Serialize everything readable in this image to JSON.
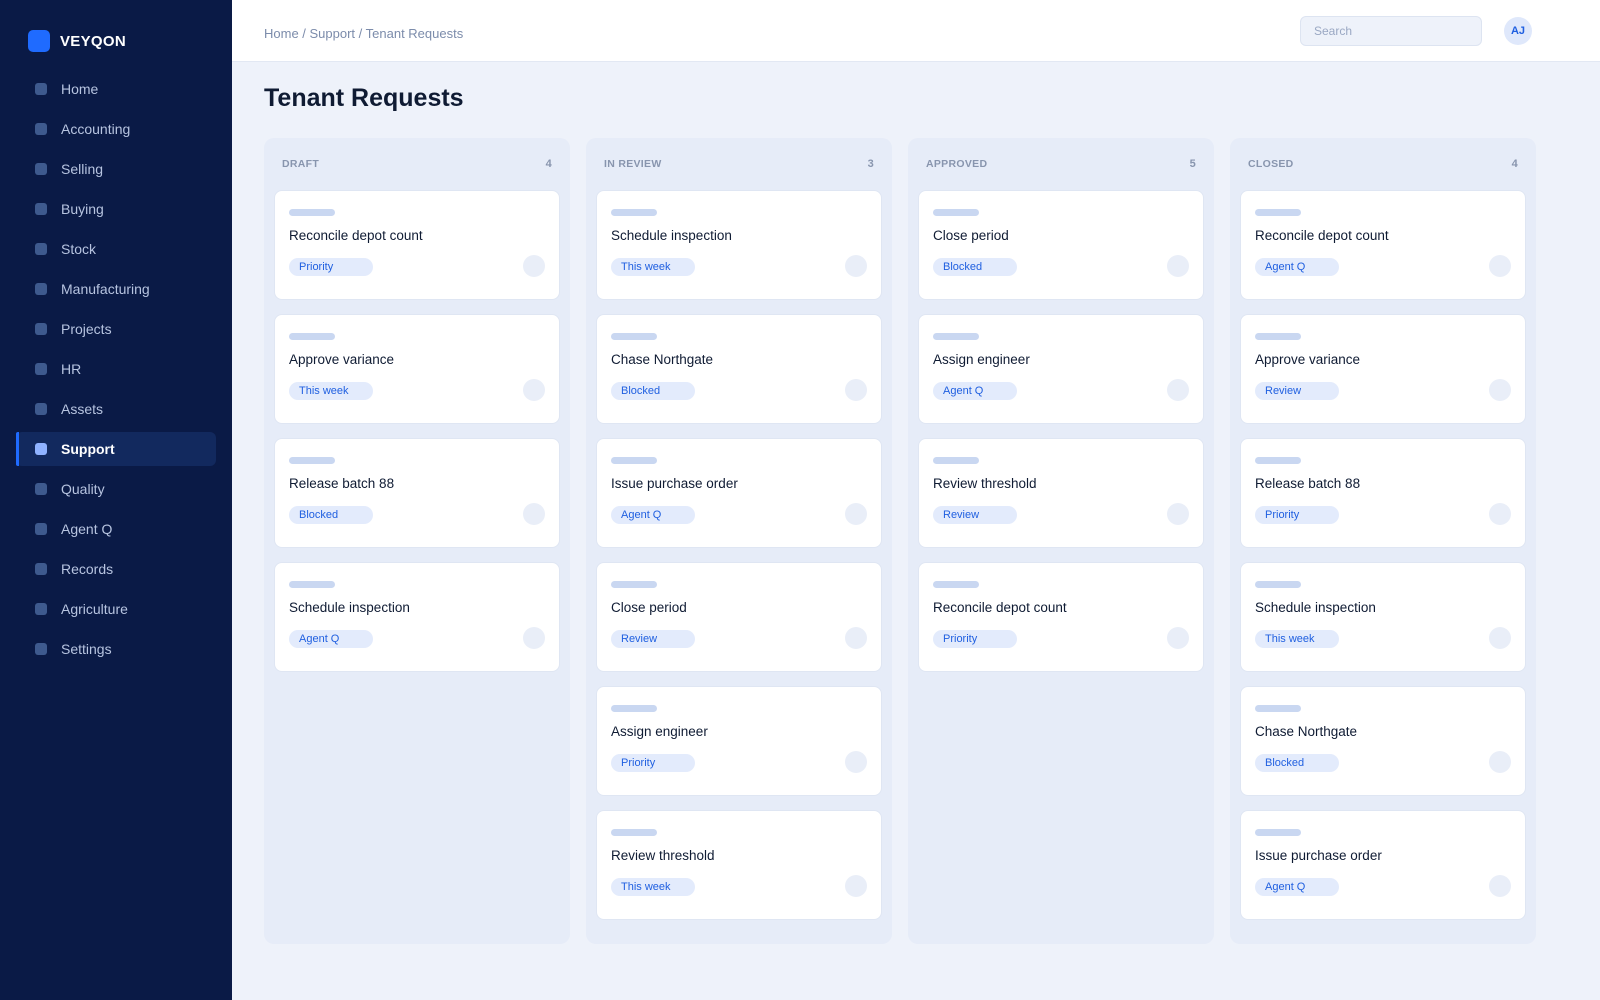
{
  "brand": {
    "name": "VEYQON",
    "logo_color": "#1f6bff"
  },
  "sidebar": {
    "items": [
      {
        "label": "Home",
        "active": false
      },
      {
        "label": "Accounting",
        "active": false
      },
      {
        "label": "Selling",
        "active": false
      },
      {
        "label": "Buying",
        "active": false
      },
      {
        "label": "Stock",
        "active": false
      },
      {
        "label": "Manufacturing",
        "active": false
      },
      {
        "label": "Projects",
        "active": false
      },
      {
        "label": "HR",
        "active": false
      },
      {
        "label": "Assets",
        "active": false
      },
      {
        "label": "Support",
        "active": true
      },
      {
        "label": "Quality",
        "active": false
      },
      {
        "label": "Agent Q",
        "active": false
      },
      {
        "label": "Records",
        "active": false
      },
      {
        "label": "Agriculture",
        "active": false
      },
      {
        "label": "Settings",
        "active": false
      }
    ]
  },
  "header": {
    "breadcrumb": "Home / Support / Tenant Requests",
    "search_placeholder": "Search",
    "avatar_initials": "AJ"
  },
  "page": {
    "title": "Tenant Requests"
  },
  "board": {
    "columns": [
      {
        "title": "DRAFT",
        "count": "4",
        "cards": [
          {
            "title": "Reconcile depot count",
            "tag": "Priority"
          },
          {
            "title": "Approve variance",
            "tag": "This week"
          },
          {
            "title": "Release batch 88",
            "tag": "Blocked"
          },
          {
            "title": "Schedule inspection",
            "tag": "Agent Q"
          }
        ]
      },
      {
        "title": "IN REVIEW",
        "count": "3",
        "cards": [
          {
            "title": "Schedule inspection",
            "tag": "This week"
          },
          {
            "title": "Chase Northgate",
            "tag": "Blocked"
          },
          {
            "title": "Issue purchase order",
            "tag": "Agent Q"
          },
          {
            "title": "Close period",
            "tag": "Review"
          },
          {
            "title": "Assign engineer",
            "tag": "Priority"
          },
          {
            "title": "Review threshold",
            "tag": "This week"
          }
        ]
      },
      {
        "title": "APPROVED",
        "count": "5",
        "cards": [
          {
            "title": "Close period",
            "tag": "Blocked"
          },
          {
            "title": "Assign engineer",
            "tag": "Agent Q"
          },
          {
            "title": "Review threshold",
            "tag": "Review"
          },
          {
            "title": "Reconcile depot count",
            "tag": "Priority"
          }
        ]
      },
      {
        "title": "CLOSED",
        "count": "4",
        "cards": [
          {
            "title": "Reconcile depot count",
            "tag": "Agent Q"
          },
          {
            "title": "Approve variance",
            "tag": "Review"
          },
          {
            "title": "Release batch 88",
            "tag": "Priority"
          },
          {
            "title": "Schedule inspection",
            "tag": "This week"
          },
          {
            "title": "Chase Northgate",
            "tag": "Blocked"
          },
          {
            "title": "Issue purchase order",
            "tag": "Agent Q"
          }
        ]
      }
    ]
  }
}
